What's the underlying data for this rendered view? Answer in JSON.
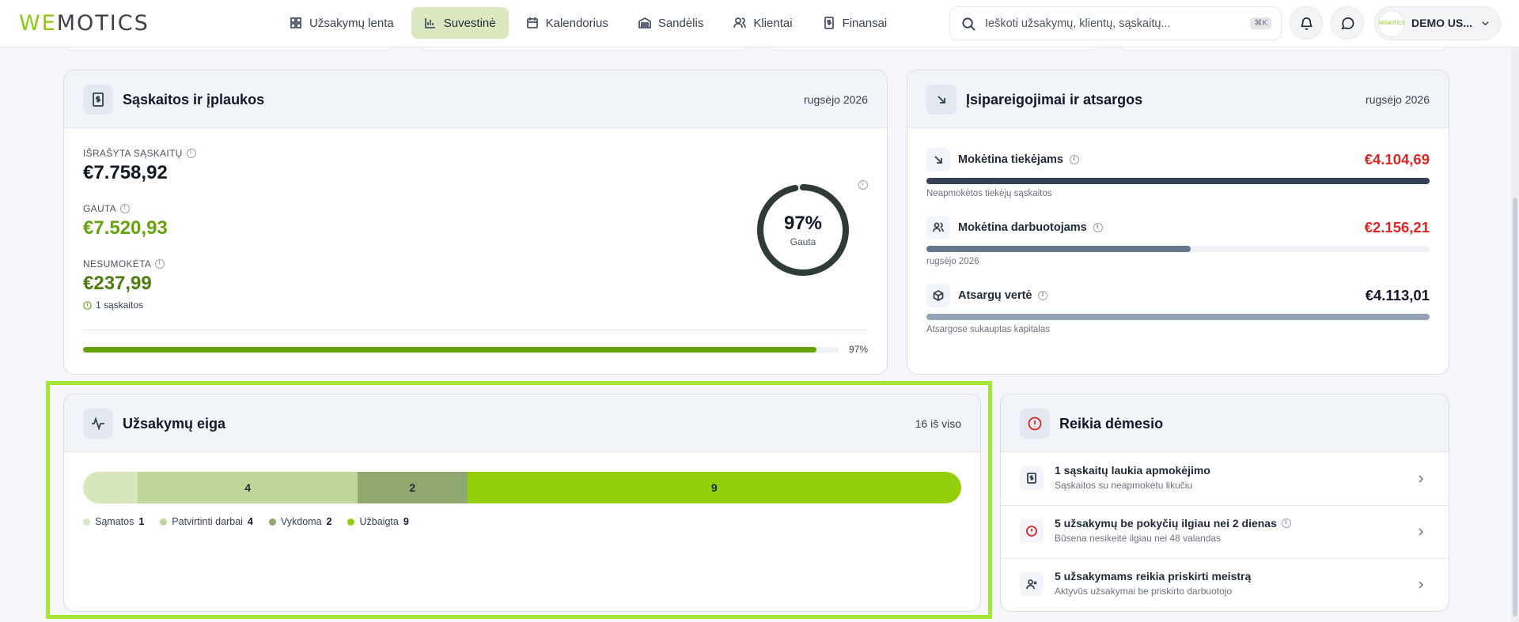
{
  "brand": {
    "logo_we": "WE",
    "logo_rest": "MOTICS",
    "logo_small": "WEMOTICS"
  },
  "nav": [
    {
      "label": "Užsakymų lenta",
      "icon": "board-icon",
      "active": false
    },
    {
      "label": "Suvestinė",
      "icon": "bar-chart-icon",
      "active": true
    },
    {
      "label": "Kalendorius",
      "icon": "calendar-icon",
      "active": false
    },
    {
      "label": "Sandėlis",
      "icon": "warehouse-icon",
      "active": false
    },
    {
      "label": "Klientai",
      "icon": "users-icon",
      "active": false
    },
    {
      "label": "Finansai",
      "icon": "dollar-doc-icon",
      "active": false
    }
  ],
  "search": {
    "placeholder": "Ieškoti užsakymų, klientų, sąskaitų...",
    "shortcut": "⌘K"
  },
  "user": {
    "name": "DEMO US..."
  },
  "invoices": {
    "title": "Sąskaitos ir įplaukos",
    "period": "rugsėjo 2026",
    "issued_label": "IŠRAŠYTA SĄSKAITŲ",
    "issued_value": "€7.758,92",
    "received_label": "GAUTA",
    "received_value": "€7.520,93",
    "unpaid_label": "NESUMOKĖTA",
    "unpaid_value": "€237,99",
    "unpaid_note": "1 sąskaitos",
    "ring_percent": "97%",
    "ring_label": "Gauta",
    "ring_fraction": 0.97,
    "progress_label": "97%",
    "progress_fraction": 0.97
  },
  "liabilities": {
    "title": "Įsipareigojimai ir atsargos",
    "period": "rugsėjo 2026",
    "rows": [
      {
        "label": "Mokėtina tiekėjams",
        "amount": "€4.104,69",
        "sub": "Neapmokėtos tiekėjų sąskaitos",
        "fraction": 1.0,
        "color": "#334155",
        "amount_color": "#dc2626",
        "icon": "arrow-down-right-icon"
      },
      {
        "label": "Mokėtina darbuotojams",
        "amount": "€2.156,21",
        "sub": "rugsėjo 2026",
        "fraction": 0.525,
        "color": "#64748b",
        "amount_color": "#dc2626",
        "icon": "users-icon"
      },
      {
        "label": "Atsargų vertė",
        "amount": "€4.113,01",
        "sub": "Atsargose sukauptas kapitalas",
        "fraction": 1.0,
        "color": "#94a3b8",
        "amount_color": "#111827",
        "icon": "box-icon"
      }
    ]
  },
  "orders": {
    "title": "Užsakymų eiga",
    "meta": "16 iš viso",
    "segments": [
      {
        "name": "Sąmatos",
        "count": 1,
        "color": "#d7e6bd",
        "show_label": false
      },
      {
        "name": "Patvirtinti darbai",
        "count": 4,
        "color": "#bfd59a",
        "show_label": true
      },
      {
        "name": "Vykdoma",
        "count": 2,
        "color": "#8fa870",
        "show_label": true
      },
      {
        "name": "Užbaigta",
        "count": 9,
        "color": "#93cf0b",
        "show_label": true
      }
    ]
  },
  "attention": {
    "title": "Reikia dėmesio",
    "items": [
      {
        "title": "1 sąskaitų laukia apmokėjimo",
        "sub": "Sąskaitos su neapmokėtu likučiu",
        "icon": "invoice-icon",
        "info": false
      },
      {
        "title": "5 užsakymų be pokyčių ilgiau nei 2 dienas",
        "sub": "Būsena nesikeitė ilgiau nei 48 valandas",
        "icon": "alert-circle-icon",
        "info": true
      },
      {
        "title": "5 užsakymams reikia priskirti meistrą",
        "sub": "Aktyvūs užsakymai be priskirto darbuotojo",
        "icon": "user-x-icon",
        "info": false
      }
    ]
  },
  "colors": {
    "accent": "#8cc814",
    "highlight_border": "#a3e635",
    "danger": "#dc2626",
    "positive": "#65a30d",
    "dark_positive": "#4d7c0f",
    "ring": "#2f3b35"
  }
}
